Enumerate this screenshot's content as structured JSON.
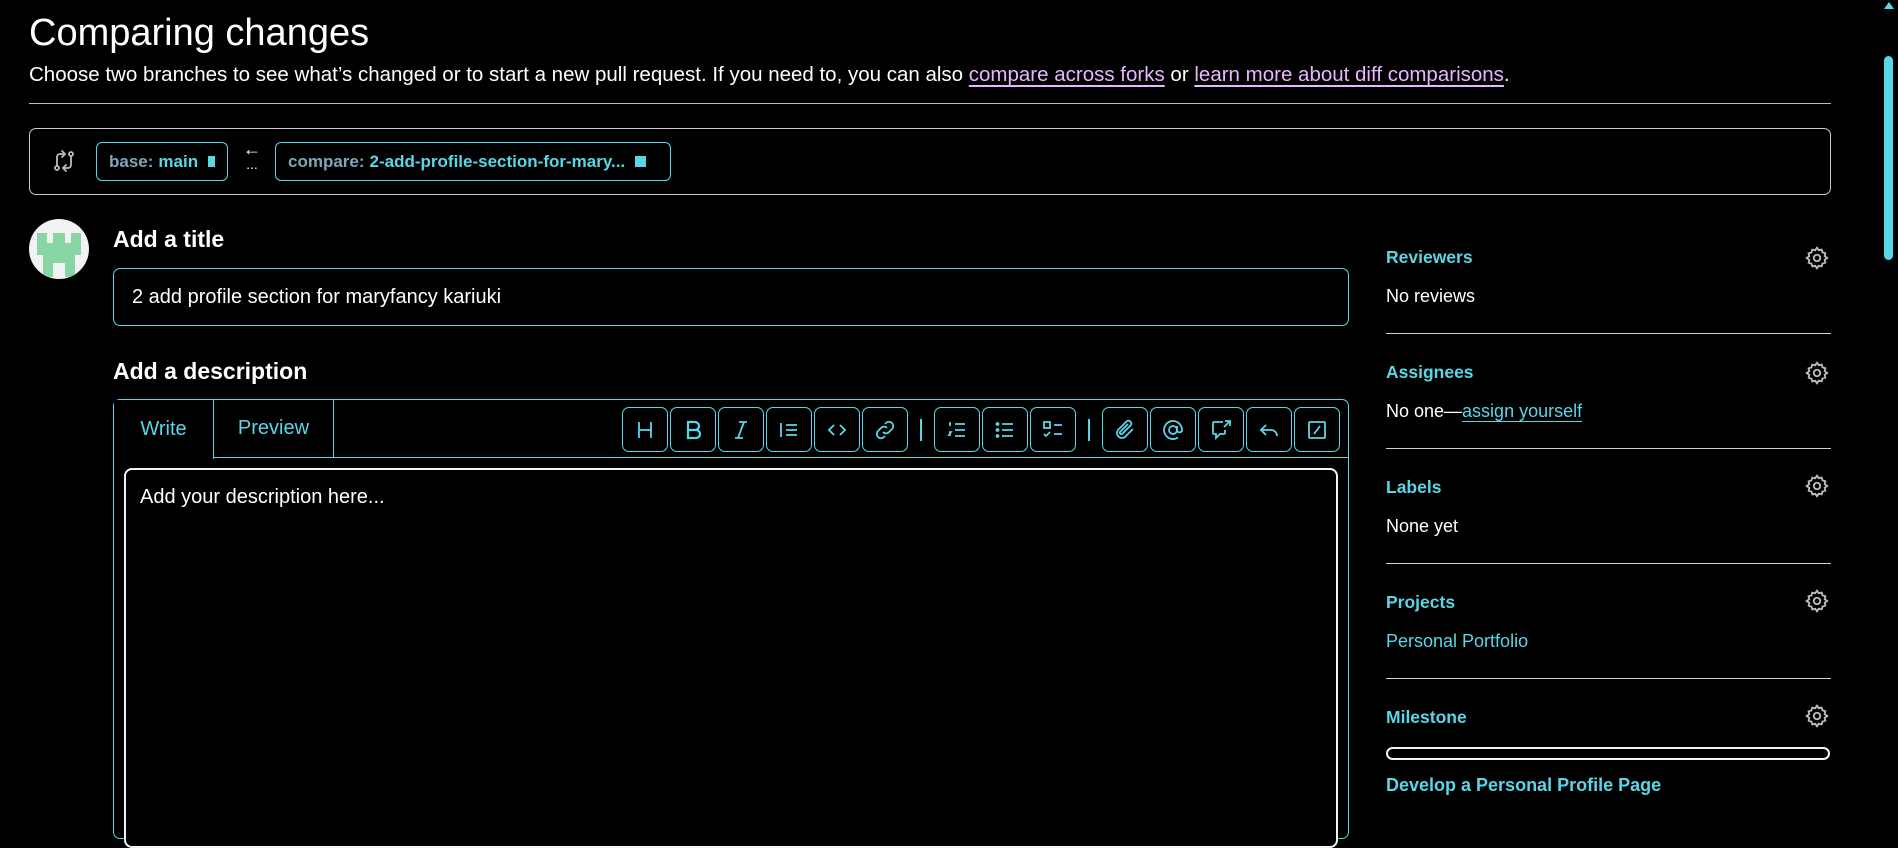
{
  "header": {
    "title": "Comparing changes",
    "subtitle_text": "Choose two branches to see what’s changed or to start a new pull request. If you need to, you can also ",
    "link_forks": "compare across forks",
    "subtitle_or": " or ",
    "link_learn": "learn more about diff comparisons",
    "subtitle_end": "."
  },
  "range": {
    "base_prefix": "base:",
    "base_branch": "main",
    "arrow": "←",
    "dots": "...",
    "compare_prefix": "compare:",
    "compare_branch": "2-add-profile-section-for-mary..."
  },
  "form": {
    "title_heading": "Add a title",
    "title_value": "2 add profile section for maryfancy kariuki",
    "desc_heading": "Add a description",
    "tab_write": "Write",
    "tab_preview": "Preview",
    "desc_placeholder": "Add your description here..."
  },
  "toolbar": [
    {
      "name": "heading-icon"
    },
    {
      "name": "bold-icon"
    },
    {
      "name": "italic-icon"
    },
    {
      "name": "quote-icon"
    },
    {
      "name": "code-icon"
    },
    {
      "name": "link-icon"
    },
    {
      "name": "ordered-list-icon"
    },
    {
      "name": "unordered-list-icon"
    },
    {
      "name": "task-list-icon"
    },
    {
      "name": "attach-icon"
    },
    {
      "name": "mention-icon"
    },
    {
      "name": "cross-reference-icon"
    },
    {
      "name": "reply-icon"
    },
    {
      "name": "slash-commands-icon"
    }
  ],
  "sidebar": {
    "reviewers_label": "Reviewers",
    "reviewers_value": "No reviews",
    "assignees_label": "Assignees",
    "assignees_value": "No one—",
    "assignees_link": "assign yourself",
    "labels_label": "Labels",
    "labels_value": "None yet",
    "projects_label": "Projects",
    "projects_value": "Personal Portfolio",
    "milestone_label": "Milestone",
    "milestone_progress": 0,
    "milestone_title": "Develop a Personal Profile Page"
  },
  "colors": {
    "accent": "#5ad6e6",
    "link": "#e8b6ff",
    "background": "#000000",
    "text": "#ffffff"
  }
}
